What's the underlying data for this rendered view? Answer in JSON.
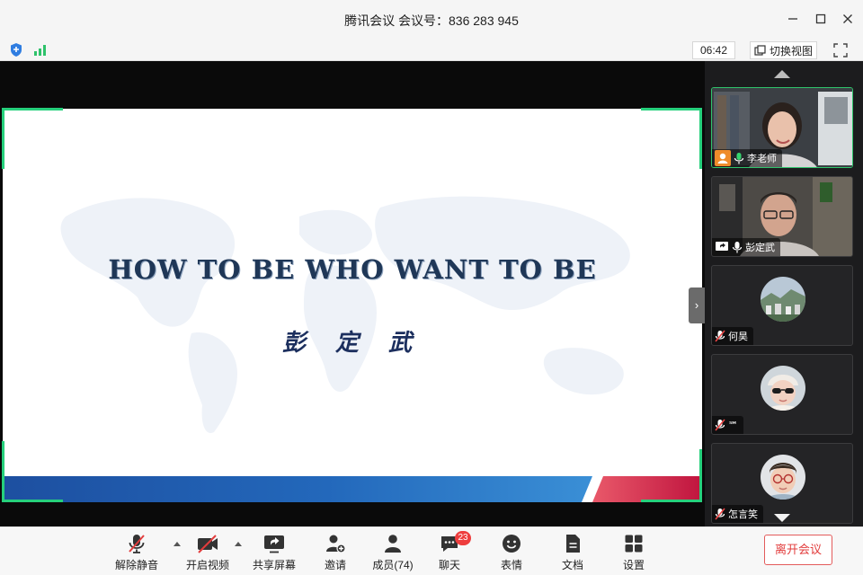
{
  "window": {
    "title": "腾讯会议 会议号：836 283 945"
  },
  "statusbar": {
    "timer": "06:42",
    "switch_view_label": "切换视图"
  },
  "slide": {
    "title": "HOW TO BE WHO WANT TO BE",
    "subtitle": "彭 定 武"
  },
  "participants": [
    {
      "name": "李老师",
      "role": "host",
      "mic": "on",
      "video": "on"
    },
    {
      "name": "彭定武",
      "role": "sharing",
      "mic": "on",
      "video": "on"
    },
    {
      "name": "何昊",
      "role": "attendee",
      "mic": "muted",
      "video": "off"
    },
    {
      "name": "℠",
      "role": "attendee",
      "mic": "muted",
      "video": "off"
    },
    {
      "name": "怎言笑",
      "role": "attendee",
      "mic": "muted",
      "video": "off"
    }
  ],
  "toolbar": {
    "unmute_label": "解除静音",
    "start_video_label": "开启视频",
    "share_screen_label": "共享屏幕",
    "invite_label": "邀请",
    "members_label": "成员(74)",
    "chat_label": "聊天",
    "chat_badge": "23",
    "reactions_label": "表情",
    "docs_label": "文档",
    "settings_label": "设置",
    "leave_label": "离开会议"
  },
  "colors": {
    "accent_green": "#26d07c",
    "leave_red": "#e23c3c",
    "slide_title_navy": "#1f3757"
  }
}
